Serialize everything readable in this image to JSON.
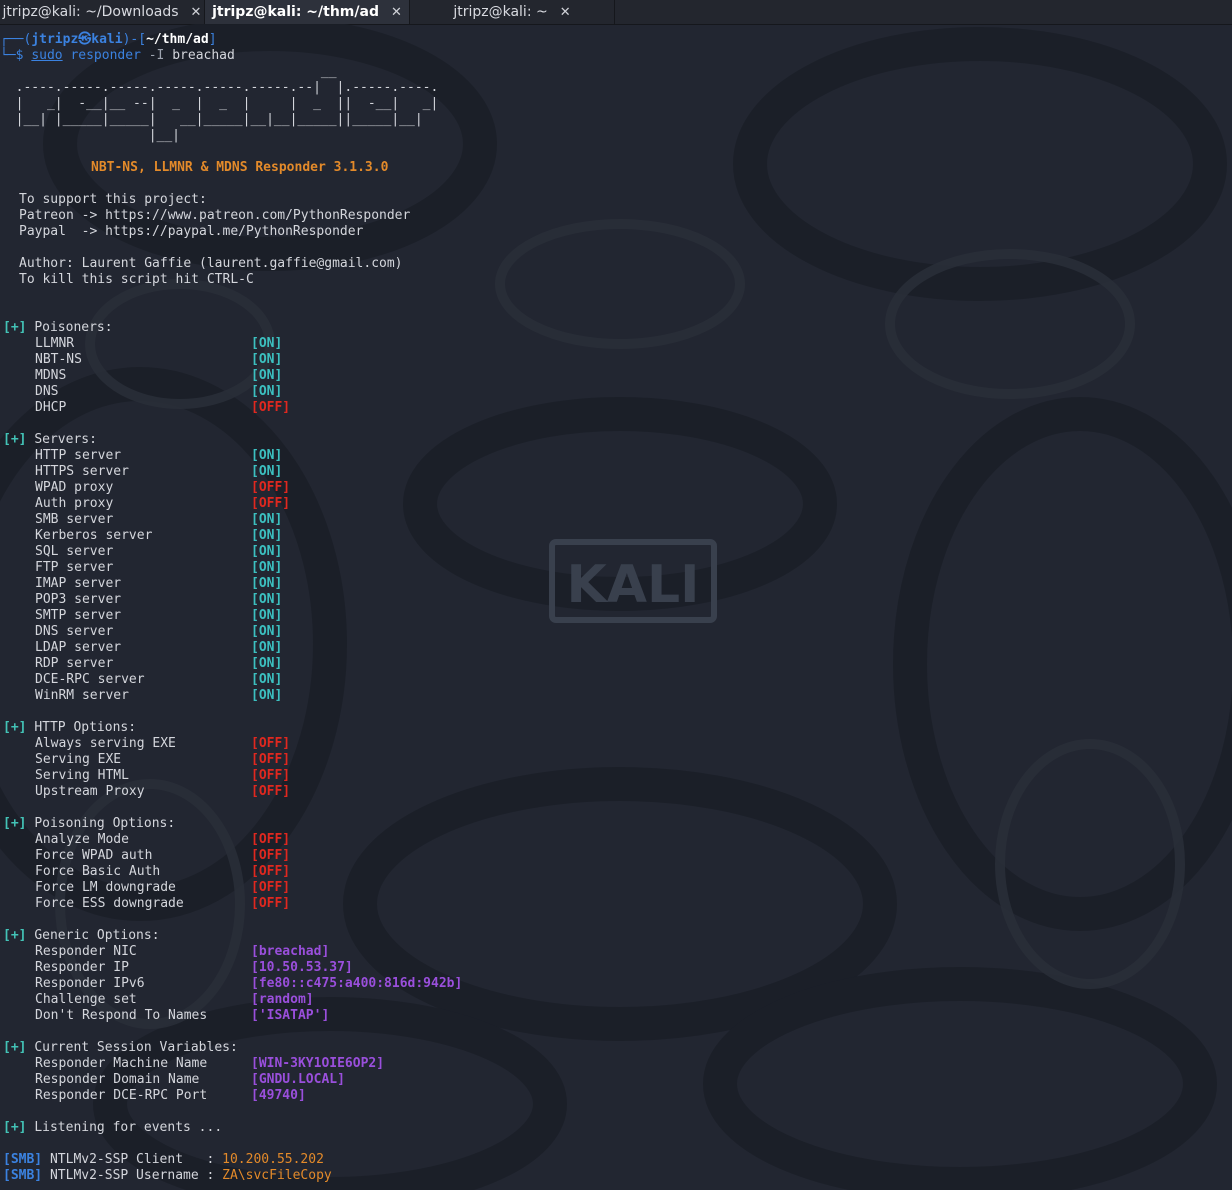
{
  "tabs": [
    {
      "label": "jtripz@kali: ~/Downloads",
      "close": "✕",
      "active": false
    },
    {
      "label": "jtripz@kali: ~/thm/ad",
      "close": "✕",
      "active": true
    },
    {
      "label": "jtripz@kali: ~",
      "close": "✕",
      "active": false
    }
  ],
  "prompt": {
    "frame_top": "┌──(",
    "user": "jtripz㉿kali",
    "frame_mid": ")-[",
    "path": "~/thm/ad",
    "frame_end": "]",
    "frame_bottom": "└─$ ",
    "cmd_sudo": "sudo",
    "cmd_name": "responder",
    "cmd_flag": "-I",
    "cmd_arg": "breachad"
  },
  "ascii_art": [
    "                                         __",
    "  .----.-----.-----.-----.-----.-----.--|  |.-----.----.",
    "  |   _|  -__|__ --|  _  |  _  |     |  _  ||  -__|   _|",
    "  |__| |_____|_____|   __|_____|__|__|_____||_____|__|",
    "                   |__|"
  ],
  "banner": "NBT-NS, LLMNR & MDNS Responder 3.1.3.0",
  "support": {
    "line1": "To support this project:",
    "patreon": "Patreon -> https://www.patreon.com/PythonResponder",
    "paypal": "Paypal  -> https://paypal.me/PythonResponder",
    "author": "Author: Laurent Gaffie (laurent.gaffie@gmail.com)",
    "kill": "To kill this script hit CTRL-C"
  },
  "plus": "[+]",
  "sections": [
    {
      "title": "Poisoners:",
      "items": [
        {
          "name": "LLMNR",
          "value": "[ON]",
          "state": "on"
        },
        {
          "name": "NBT-NS",
          "value": "[ON]",
          "state": "on"
        },
        {
          "name": "MDNS",
          "value": "[ON]",
          "state": "on"
        },
        {
          "name": "DNS",
          "value": "[ON]",
          "state": "on"
        },
        {
          "name": "DHCP",
          "value": "[OFF]",
          "state": "off"
        }
      ]
    },
    {
      "title": "Servers:",
      "items": [
        {
          "name": "HTTP server",
          "value": "[ON]",
          "state": "on"
        },
        {
          "name": "HTTPS server",
          "value": "[ON]",
          "state": "on"
        },
        {
          "name": "WPAD proxy",
          "value": "[OFF]",
          "state": "off"
        },
        {
          "name": "Auth proxy",
          "value": "[OFF]",
          "state": "off"
        },
        {
          "name": "SMB server",
          "value": "[ON]",
          "state": "on"
        },
        {
          "name": "Kerberos server",
          "value": "[ON]",
          "state": "on"
        },
        {
          "name": "SQL server",
          "value": "[ON]",
          "state": "on"
        },
        {
          "name": "FTP server",
          "value": "[ON]",
          "state": "on"
        },
        {
          "name": "IMAP server",
          "value": "[ON]",
          "state": "on"
        },
        {
          "name": "POP3 server",
          "value": "[ON]",
          "state": "on"
        },
        {
          "name": "SMTP server",
          "value": "[ON]",
          "state": "on"
        },
        {
          "name": "DNS server",
          "value": "[ON]",
          "state": "on"
        },
        {
          "name": "LDAP server",
          "value": "[ON]",
          "state": "on"
        },
        {
          "name": "RDP server",
          "value": "[ON]",
          "state": "on"
        },
        {
          "name": "DCE-RPC server",
          "value": "[ON]",
          "state": "on"
        },
        {
          "name": "WinRM server",
          "value": "[ON]",
          "state": "on"
        }
      ]
    },
    {
      "title": "HTTP Options:",
      "items": [
        {
          "name": "Always serving EXE",
          "value": "[OFF]",
          "state": "off"
        },
        {
          "name": "Serving EXE",
          "value": "[OFF]",
          "state": "off"
        },
        {
          "name": "Serving HTML",
          "value": "[OFF]",
          "state": "off"
        },
        {
          "name": "Upstream Proxy",
          "value": "[OFF]",
          "state": "off"
        }
      ]
    },
    {
      "title": "Poisoning Options:",
      "items": [
        {
          "name": "Analyze Mode",
          "value": "[OFF]",
          "state": "off"
        },
        {
          "name": "Force WPAD auth",
          "value": "[OFF]",
          "state": "off"
        },
        {
          "name": "Force Basic Auth",
          "value": "[OFF]",
          "state": "off"
        },
        {
          "name": "Force LM downgrade",
          "value": "[OFF]",
          "state": "off"
        },
        {
          "name": "Force ESS downgrade",
          "value": "[OFF]",
          "state": "off"
        }
      ]
    },
    {
      "title": "Generic Options:",
      "items": [
        {
          "name": "Responder NIC",
          "value": "[breachad]",
          "state": "val"
        },
        {
          "name": "Responder IP",
          "value": "[10.50.53.37]",
          "state": "val"
        },
        {
          "name": "Responder IPv6",
          "value": "[fe80::c475:a400:816d:942b]",
          "state": "val"
        },
        {
          "name": "Challenge set",
          "value": "[random]",
          "state": "val"
        },
        {
          "name": "Don't Respond To Names",
          "value": "['ISATAP']",
          "state": "val"
        }
      ]
    },
    {
      "title": "Current Session Variables:",
      "items": [
        {
          "name": "Responder Machine Name",
          "value": "[WIN-3KY1OIE6OP2]",
          "state": "val"
        },
        {
          "name": "Responder Domain Name",
          "value": "[GNDU.LOCAL]",
          "state": "val"
        },
        {
          "name": "Responder DCE-RPC Port",
          "value": "[49740]",
          "state": "val"
        }
      ]
    }
  ],
  "listening": "Listening for events ...",
  "events": [
    {
      "tag": "[SMB]",
      "label": "NTLMv2-SSP Client   : ",
      "value": "10.200.55.202"
    },
    {
      "tag": "[SMB]",
      "label": "NTLMv2-SSP Username : ",
      "value": "ZA\\svcFileCopy"
    }
  ],
  "watermark": "KALI",
  "colors": {
    "background": "#222631",
    "on": "#3cc0c0",
    "off": "#e0281f",
    "value": "#9a4fdc",
    "banner": "#e38a2a",
    "prompt": "#3b82e0"
  }
}
